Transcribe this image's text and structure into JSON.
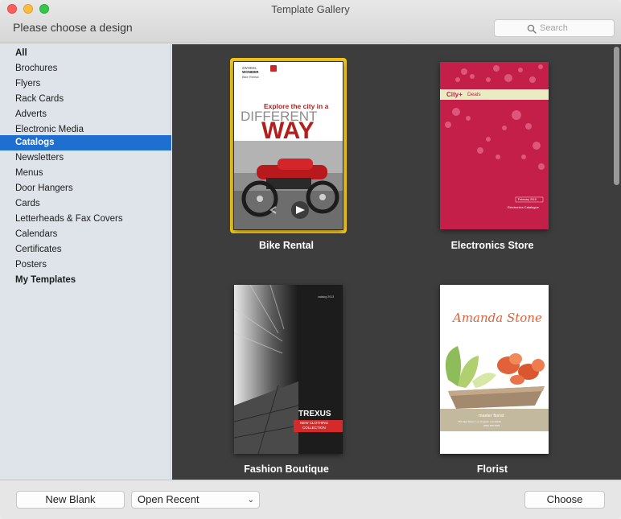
{
  "window": {
    "title": "Template Gallery",
    "subtitle": "Please choose a design"
  },
  "search": {
    "placeholder": "Search",
    "icon": "search-icon"
  },
  "sidebar": {
    "items": [
      {
        "label": "All",
        "bold": true,
        "selected": false
      },
      {
        "label": "Brochures",
        "bold": false,
        "selected": false
      },
      {
        "label": "Flyers",
        "bold": false,
        "selected": false
      },
      {
        "label": "Rack Cards",
        "bold": false,
        "selected": false
      },
      {
        "label": "Adverts",
        "bold": false,
        "selected": false
      },
      {
        "label": "Electronic Media",
        "bold": false,
        "selected": false
      },
      {
        "label": "Catalogs",
        "bold": true,
        "selected": true
      },
      {
        "label": "Newsletters",
        "bold": false,
        "selected": false
      },
      {
        "label": "Menus",
        "bold": false,
        "selected": false
      },
      {
        "label": "Door Hangers",
        "bold": false,
        "selected": false
      },
      {
        "label": "Cards",
        "bold": false,
        "selected": false
      },
      {
        "label": "Letterheads & Fax Covers",
        "bold": false,
        "selected": false
      },
      {
        "label": "Calendars",
        "bold": false,
        "selected": false
      },
      {
        "label": "Certificates",
        "bold": false,
        "selected": false
      },
      {
        "label": "Posters",
        "bold": false,
        "selected": false
      },
      {
        "label": "My Templates",
        "bold": true,
        "selected": false
      }
    ]
  },
  "templates": [
    {
      "name": "Bike Rental",
      "selected": true,
      "brand_line1": "2WHEEL",
      "brand_line2": "WONDER",
      "brand_line3": "Bike Rental",
      "headline1": "Explore the city in a",
      "headline2": "DIFFERENT",
      "headline3": "WAY"
    },
    {
      "name": "Electronics Store",
      "selected": false,
      "banner": "City+",
      "banner_sub": "Deals",
      "date": "February 2015",
      "footer_text": "Electronics Catalogue"
    },
    {
      "name": "Fashion Boutique",
      "selected": false,
      "corner_text": "catalog 2013",
      "brand": "TREXUS",
      "tagline1": "NEW CLOTHING",
      "tagline2": "COLLECTION"
    },
    {
      "name": "Florist",
      "selected": false,
      "title": "Amanda Stone",
      "sub": "master florist",
      "address": "765 High Street, Los Angeles, CA 90210",
      "phone": "(555) 555 5555"
    }
  ],
  "footer": {
    "new_blank": "New Blank",
    "open_recent": "Open Recent",
    "choose": "Choose"
  },
  "colors": {
    "selection": "#1e6fd0",
    "highlight_frame": "#f3c61a",
    "gallery_bg": "#3d3d3d",
    "electronics_red": "#c41f48",
    "bike_red": "#b31e1e"
  }
}
